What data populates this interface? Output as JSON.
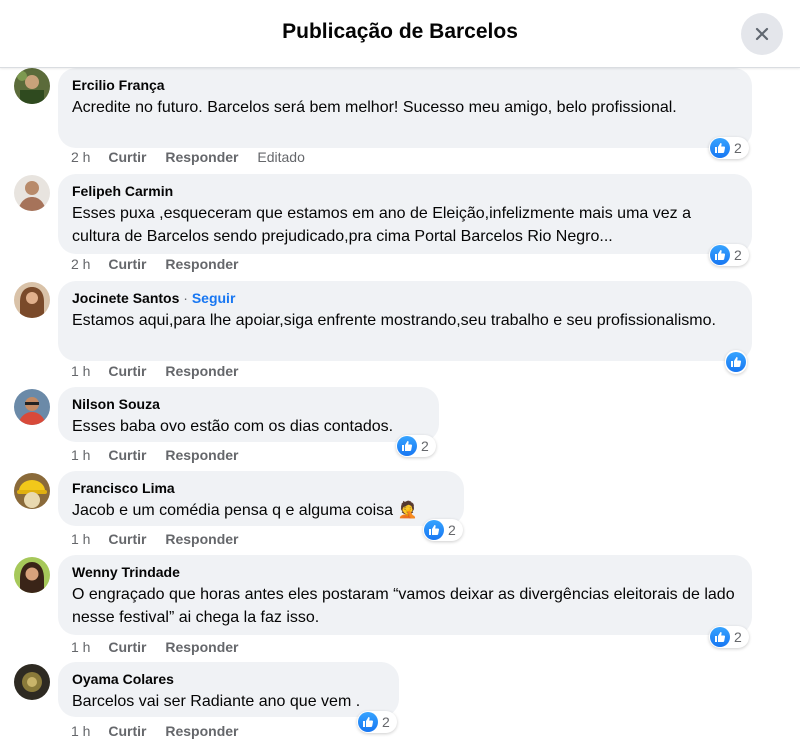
{
  "header": {
    "title": "Publicação de Barcelos",
    "close_icon": "close-icon"
  },
  "actions": {
    "like": "Curtir",
    "reply": "Responder",
    "follow": "Seguir"
  },
  "comments": [
    {
      "author": "Ercilio França",
      "text": "Acredite no futuro. Barcelos será bem melhor! Sucesso meu amigo, belo profissional.",
      "time": "2 h",
      "edited": "Editado",
      "reactions": "2"
    },
    {
      "author": "Felipeh Carmin",
      "text": "Esses puxa ,esqueceram que estamos em ano de Eleição,infelizmente mais uma vez a cultura de Barcelos sendo prejudicado,pra cima Portal Barcelos Rio Negro...",
      "time": "2 h",
      "reactions": "2"
    },
    {
      "author": "Jocinete Santos",
      "text": "Estamos aqui,para lhe apoiar,siga enfrente mostrando,seu trabalho e seu profissionalismo.",
      "time": "1 h",
      "reactions": ""
    },
    {
      "author": "Nilson Souza",
      "text": "Esses baba ovo estão com os dias contados.",
      "time": "1 h",
      "reactions": "2"
    },
    {
      "author": "Francisco Lima",
      "text": "Jacob e um comédia pensa q e alguma coisa 🤦",
      "time": "1 h",
      "reactions": "2"
    },
    {
      "author": "Wenny Trindade",
      "text": "O engraçado que horas antes eles postaram “vamos deixar as divergências eleitorais de lado nesse festival” ai chega la faz isso.",
      "time": "1 h",
      "reactions": "2"
    },
    {
      "author": "Oyama Colares",
      "text": "Barcelos vai ser Radiante ano que vem .",
      "time": "1 h",
      "reactions": "2"
    }
  ]
}
